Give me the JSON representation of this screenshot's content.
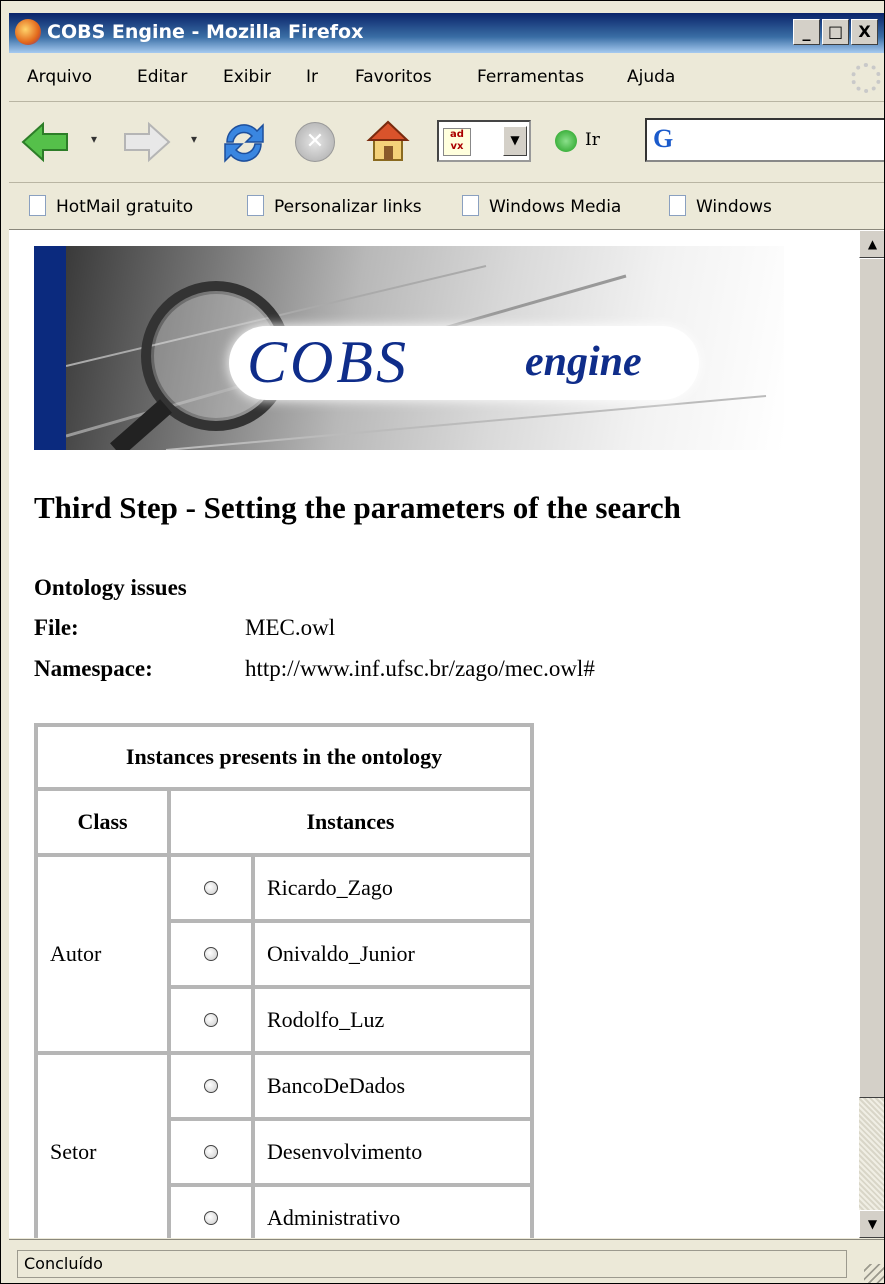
{
  "window": {
    "title": "COBS Engine - Mozilla Firefox",
    "min": "_",
    "max": "□",
    "close": "X"
  },
  "menu": [
    "Arquivo",
    "Editar",
    "Exibir",
    "Ir",
    "Favoritos",
    "Ferramentas",
    "Ajuda"
  ],
  "toolbar": {
    "go_label": "Ir",
    "dropdown_arrow": "▾",
    "google_glyph": "G"
  },
  "bookmarks": [
    "HotMail gratuito",
    "Personalizar links",
    "Windows Media",
    "Windows"
  ],
  "banner": {
    "logo_main": "COBS",
    "logo_sub": "engine"
  },
  "page": {
    "step_title": "Third Step - Setting the parameters of the search",
    "ontology_title": "Ontology issues",
    "file_label": "File:",
    "file_value": "MEC.owl",
    "namespace_label": "Namespace:",
    "namespace_value": "http://www.inf.ufsc.br/zago/mec.owl#"
  },
  "table": {
    "caption": "Instances presents in the ontology",
    "col_class": "Class",
    "col_instances": "Instances",
    "groups": [
      {
        "class": "Autor",
        "instances": [
          "Ricardo_Zago",
          "Onivaldo_Junior",
          "Rodolfo_Luz"
        ]
      },
      {
        "class": "Setor",
        "instances": [
          "BancoDeDados",
          "Desenvolvimento",
          "Administrativo"
        ]
      }
    ]
  },
  "status": {
    "text": "Concluído"
  },
  "colors": {
    "title_bar": "#0a246a",
    "banner_stripe": "#0b2a7e",
    "logo_text": "#0f2d8a",
    "table_border": "#b6b6b6"
  }
}
